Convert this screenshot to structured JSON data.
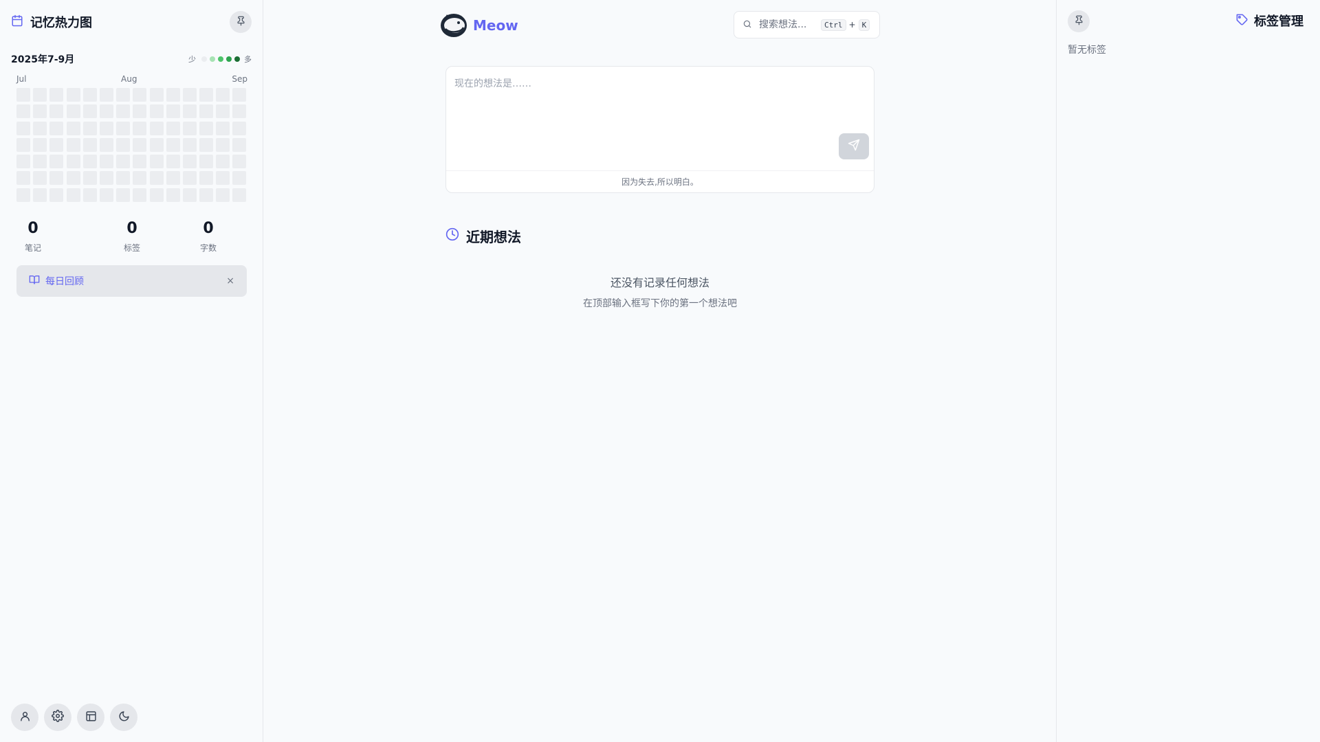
{
  "left_sidebar": {
    "title": "记忆热力图",
    "date_range": "2025年7-9月",
    "legend": {
      "less": "少",
      "more": "多",
      "colors": [
        "#ebedf0",
        "#a7e3b4",
        "#4ec46b",
        "#2ea44f",
        "#1b6e34"
      ]
    },
    "months": [
      "Jul",
      "Aug",
      "Sep"
    ],
    "heatmap": {
      "weeks": 14,
      "days": 7,
      "values": []
    },
    "stats": [
      {
        "value": "0",
        "label": "笔记"
      },
      {
        "value": "0",
        "label": "标签"
      },
      {
        "value": "0",
        "label": "字数"
      }
    ],
    "daily_review": {
      "label": "每日回顾",
      "close": "×"
    },
    "bottom_tools": [
      "user-icon",
      "settings-icon",
      "layout-icon",
      "dark-mode-icon"
    ]
  },
  "header": {
    "brand": "Meow",
    "search": {
      "placeholder": "搜索想法...",
      "shortcut_key1": "Ctrl",
      "shortcut_plus": "+",
      "shortcut_key2": "K"
    }
  },
  "editor": {
    "placeholder": "现在的想法是……",
    "footer": "因为失去,所以明白。"
  },
  "recent": {
    "title": "近期想法",
    "empty_title": "还没有记录任何想法",
    "empty_sub": "在顶部输入框写下你的第一个想法吧"
  },
  "right_sidebar": {
    "title": "标签管理",
    "empty": "暂无标签"
  },
  "colors": {
    "accent": "#6366f1",
    "border": "#e5e7eb",
    "cell_empty": "#ebedf0"
  }
}
